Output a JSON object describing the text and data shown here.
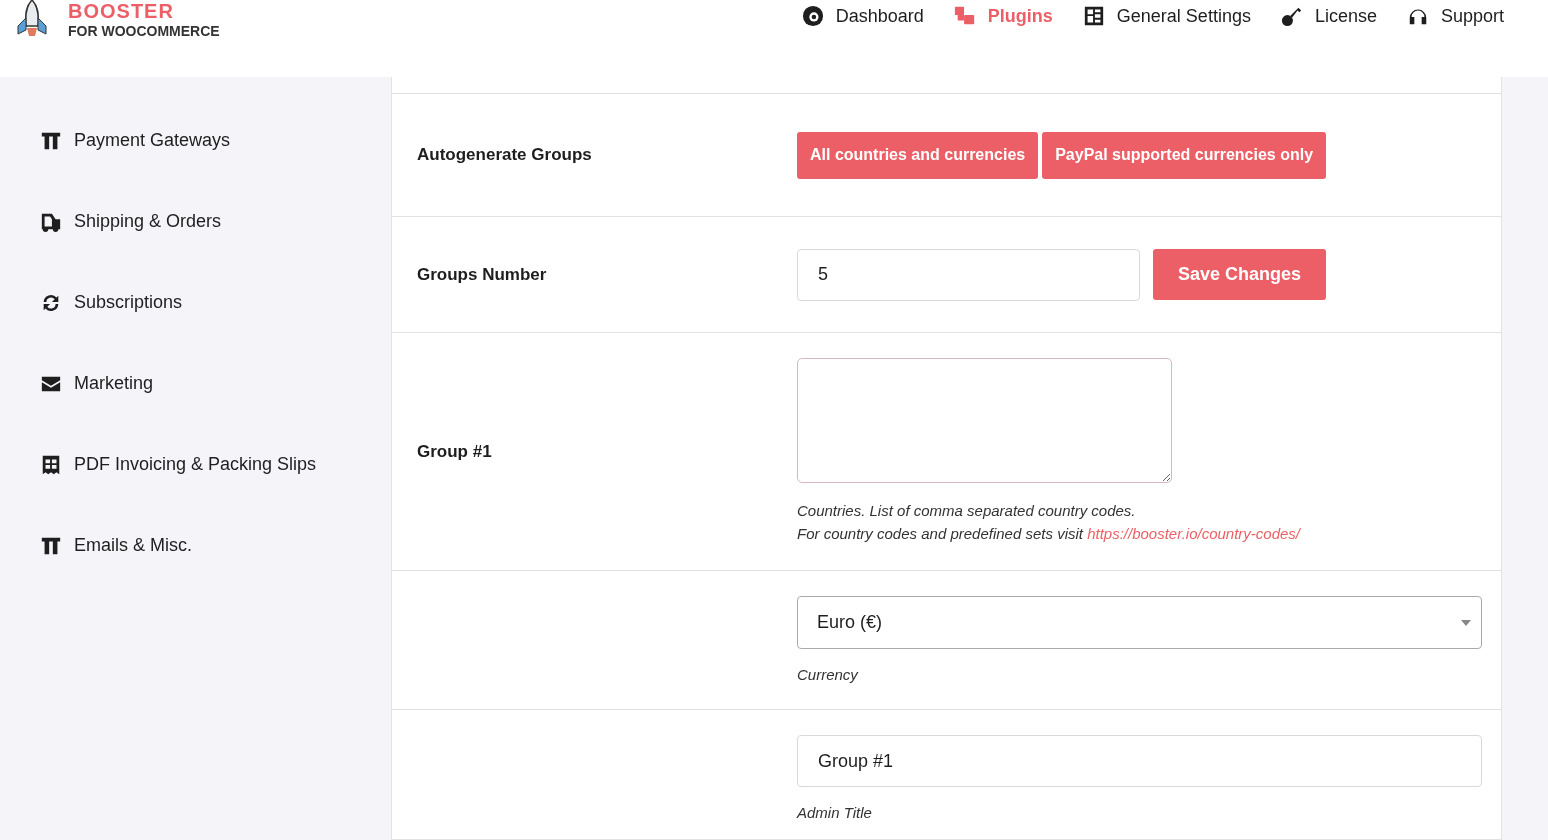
{
  "logo": {
    "title": "BOOSTER",
    "subtitle": "FOR WOOCOMMERCE"
  },
  "nav": [
    {
      "label": "Dashboard",
      "selected": false
    },
    {
      "label": "Plugins",
      "selected": true
    },
    {
      "label": "General Settings",
      "selected": false
    },
    {
      "label": "License",
      "selected": false
    },
    {
      "label": "Support",
      "selected": false
    }
  ],
  "sidebar": {
    "items": [
      {
        "label": "Payment Gateways"
      },
      {
        "label": "Shipping & Orders"
      },
      {
        "label": "Subscriptions"
      },
      {
        "label": "Marketing"
      },
      {
        "label": "PDF Invoicing & Packing Slips"
      },
      {
        "label": "Emails & Misc."
      }
    ]
  },
  "settings": [
    {
      "kind": "buttons",
      "label": "Autogenerate Groups",
      "buttons": [
        "All countries and currencies",
        "PayPal supported currencies only"
      ]
    },
    {
      "kind": "number",
      "label": "Groups Number",
      "value": "5",
      "button": "Save Changes"
    },
    {
      "kind": "textarea",
      "label": "Group #1",
      "description": "Countries. List of comma separated country codes.",
      "description_2": "For country codes and predefined sets visit",
      "link": "https://booster.io/country-codes/"
    },
    {
      "kind": "select",
      "value": "Euro (€)",
      "description": "Currency"
    },
    {
      "kind": "text",
      "value": "Group #1",
      "description": "Admin Title"
    }
  ]
}
